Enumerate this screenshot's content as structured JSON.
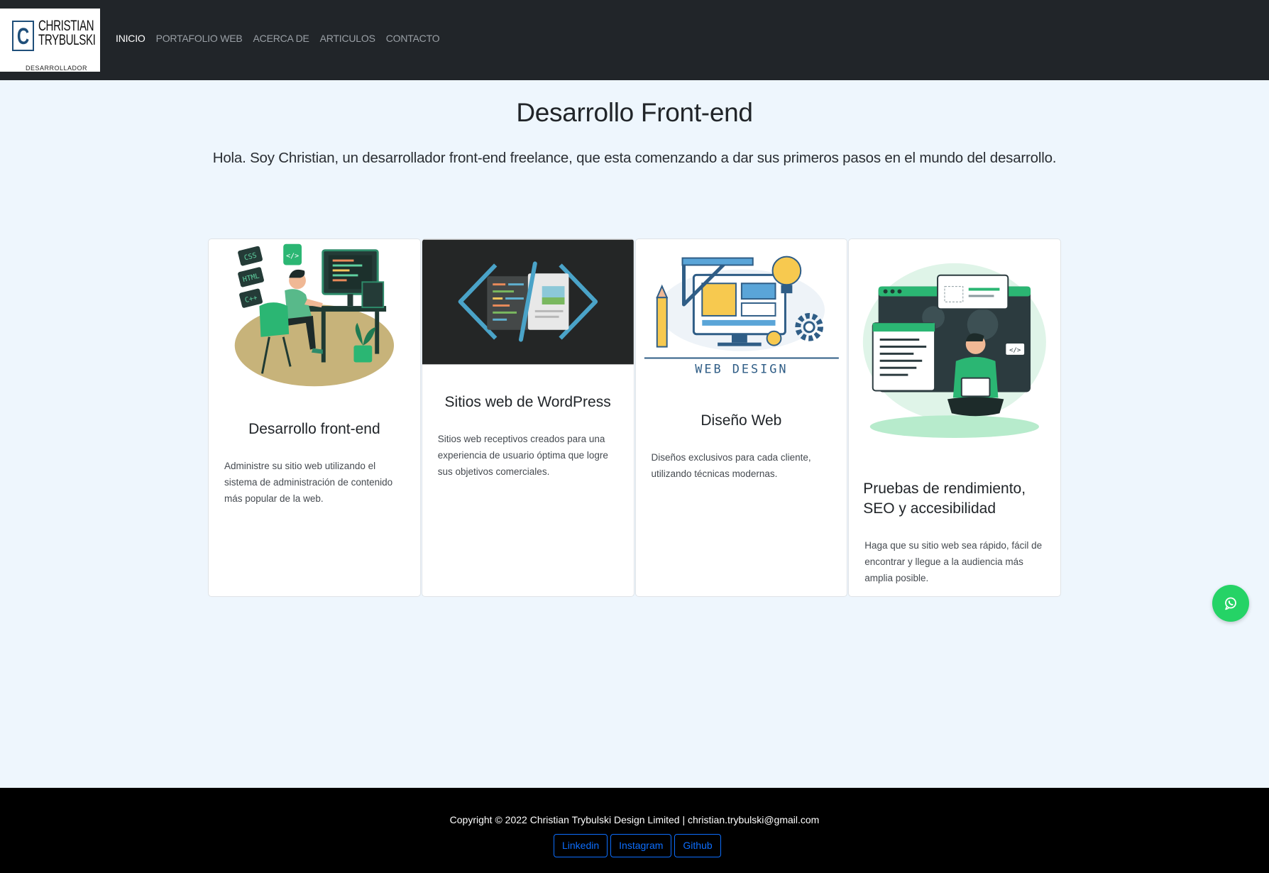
{
  "brand": {
    "name_line1": "CHRISTIAN",
    "name_line2": "TRYBULSKI",
    "tagline": "DESARROLLADOR",
    "mark": "C"
  },
  "nav": {
    "items": [
      {
        "label": "INICIO",
        "active": true
      },
      {
        "label": "PORTAFOLIO WEB",
        "active": false
      },
      {
        "label": "ACERCA DE",
        "active": false
      },
      {
        "label": "ARTICULOS",
        "active": false
      },
      {
        "label": "CONTACTO",
        "active": false
      }
    ]
  },
  "hero": {
    "title": "Desarrollo Front-end",
    "subtitle": "Hola. Soy Christian, un desarrollador front-end freelance, que esta comenzando a dar sus primeros pasos en el mundo del desarrollo."
  },
  "cards": [
    {
      "title": "Desarrollo front-end",
      "text": "Administre su sitio web utilizando el sistema de administración de contenido más popular de la web.",
      "image": "developer-at-desk-illustration",
      "badges": [
        "CSS",
        "HTML",
        "C++"
      ]
    },
    {
      "title": "Sitios web de WordPress",
      "text": "Sitios web receptivos creados para una experiencia de usuario óptima que logre sus objetivos comerciales.",
      "image": "code-brackets-illustration"
    },
    {
      "title": "Diseño Web",
      "text": "Diseños exclusivos para cada cliente, utilizando técnicas modernas.",
      "image": "web-design-illustration",
      "image_caption": "WEB DESIGN"
    },
    {
      "title": "Pruebas de rendimiento, SEO y accesibilidad",
      "text": "Haga que su sitio web sea rápido, fácil de encontrar y llegue a la audiencia más amplia posible.",
      "image": "developer-with-laptop-illustration"
    }
  ],
  "whatsapp": {
    "icon": "whatsapp-icon",
    "color": "#25d366"
  },
  "footer": {
    "copyright": "Copyright © 2022 Christian Trybulski Design Limited | christian.trybulski@gmail.com",
    "links": [
      "Linkedin",
      "Instagram",
      "Github"
    ]
  },
  "colors": {
    "navbar": "#212529",
    "page_bg": "#eef6fd",
    "footer": "#000000",
    "link_blue": "#0d6efd",
    "accent_green": "#2bb673"
  }
}
